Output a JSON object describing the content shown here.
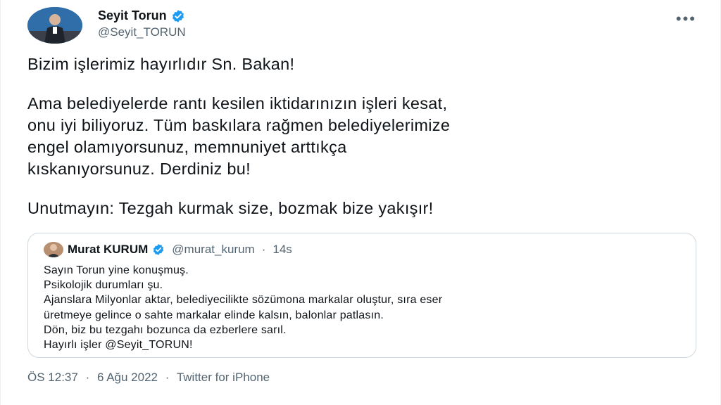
{
  "author": {
    "name": "Seyit Torun",
    "handle": "@Seyit_TORUN"
  },
  "tweet": {
    "paragraphs": [
      [
        "Bizim işlerimiz hayırlıdır Sn. Bakan!"
      ],
      [
        "Ama belediyelerde rantı kesilen iktidarınızın işleri kesat,",
        "onu iyi biliyoruz. Tüm baskılara rağmen belediyelerimize",
        "engel olamıyorsunuz, memnuniyet arttıkça",
        "kıskanıyorsunuz. Derdiniz bu!"
      ],
      [
        "Unutmayın: Tezgah kurmak size, bozmak bize yakışır!"
      ]
    ]
  },
  "quote": {
    "name": "Murat KURUM",
    "handle": "@murat_kurum",
    "separator": "·",
    "time": "14s",
    "lines": [
      "Sayın Torun yine konuşmuş.",
      "Psikolojik durumları şu.",
      "Ajanslara Milyonlar aktar, belediyecilikte sözümona markalar oluştur, sıra eser",
      "üretmeye gelince o sahte markalar elinde kalsın, balonlar patlasın.",
      "Dön, biz bu tezgahı bozunca da ezberlere sarıl.",
      "Hayırlı işler @Seyit_TORUN!"
    ]
  },
  "footer": {
    "time": "ÖS 12:37",
    "separator": "·",
    "date": "6 Ağu 2022",
    "source": "Twitter for iPhone"
  },
  "icons": {
    "verified": "verified-badge-icon",
    "more": "more-options-icon"
  },
  "colors": {
    "text_primary": "#0f1419",
    "text_secondary": "#536471",
    "verified_blue": "#1d9bf0",
    "border": "#cfd9de"
  }
}
